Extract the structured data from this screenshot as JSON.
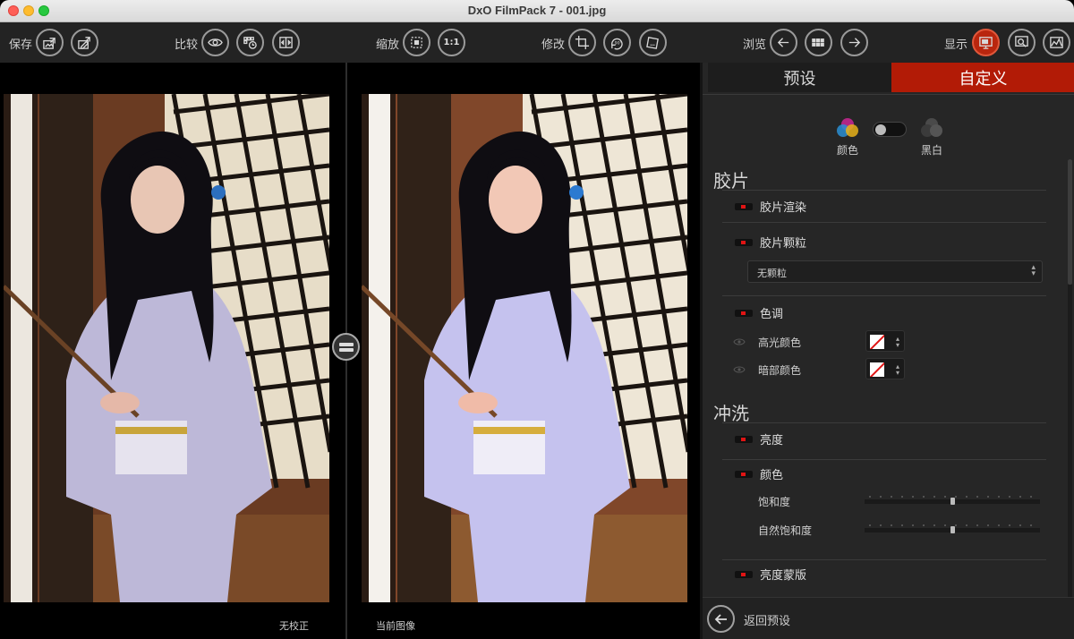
{
  "window": {
    "title": "DxO FilmPack 7 - 001.jpg"
  },
  "toolbar": {
    "save_label": "保存",
    "compare_label": "比较",
    "zoom_label": "缩放",
    "zoom_one_to_one": "1:1",
    "modify_label": "修改",
    "browse_label": "浏览",
    "display_label": "显示"
  },
  "viewer": {
    "left_caption": "无校正",
    "right_caption": "当前图像"
  },
  "panel": {
    "tabs": [
      {
        "label": "预设"
      },
      {
        "label": "自定义"
      }
    ],
    "mode": {
      "color_label": "颜色",
      "bw_label": "黑白",
      "bw_enabled": false
    },
    "film": {
      "title": "胶片",
      "rendering_label": "胶片渲染",
      "grain_label": "胶片颗粒",
      "grain_select": "无颗粒",
      "toning_label": "色调",
      "highlight_color_label": "高光颜色",
      "shadow_color_label": "暗部颜色"
    },
    "develop": {
      "title": "冲洗",
      "brightness_label": "亮度",
      "color_label": "颜色",
      "saturation_label": "饱和度",
      "vibrance_label": "自然饱和度",
      "luminance_mask_label": "亮度蒙版",
      "saturation_value": 0.5,
      "vibrance_value": 0.5
    },
    "footer": {
      "back_label": "返回预设"
    }
  },
  "colors": {
    "accent": "#b21b06",
    "checkbox_mark": "#e01414"
  }
}
